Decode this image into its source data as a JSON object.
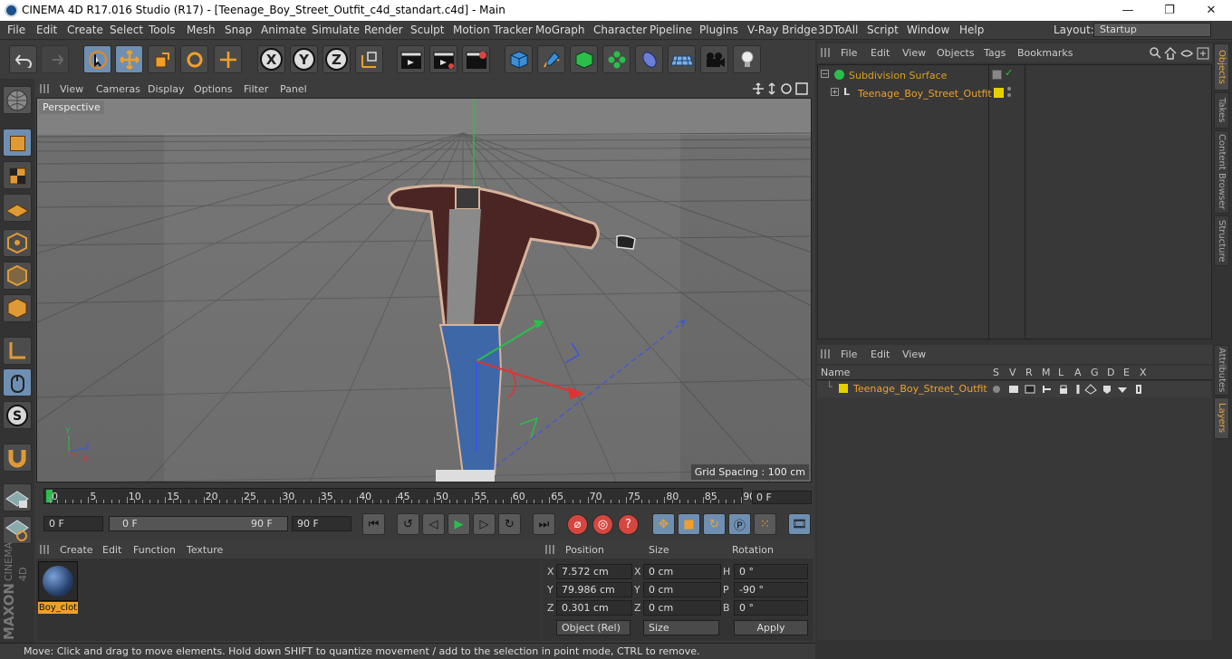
{
  "window": {
    "title": "CINEMA 4D R17.016 Studio (R17) - [Teenage_Boy_Street_Outfit_c4d_standart.c4d] - Main",
    "min_icon": "—",
    "max_icon": "❐",
    "close_icon": "✕"
  },
  "menu": [
    "File",
    "Edit",
    "Create",
    "Select",
    "Tools",
    "Mesh",
    "Snap",
    "Animate",
    "Simulate",
    "Render",
    "Sculpt",
    "Motion Tracker",
    "MoGraph",
    "Character",
    "Pipeline",
    "Plugins",
    "V-Ray Bridge",
    "3DToAll",
    "Script",
    "Window",
    "Help"
  ],
  "layout": {
    "label": "Layout:",
    "value": "Startup"
  },
  "toolbar": {
    "x": "X",
    "y": "Y",
    "z": "Z"
  },
  "viewport": {
    "menu": [
      "View",
      "Cameras",
      "Display",
      "Options",
      "Filter",
      "Panel"
    ],
    "label": "Perspective",
    "grid_spacing": "Grid Spacing : 100 cm"
  },
  "timeline": {
    "ticks": [
      "0",
      "5",
      "10",
      "15",
      "20",
      "25",
      "30",
      "35",
      "40",
      "45",
      "50",
      "55",
      "60",
      "65",
      "70",
      "75",
      "80",
      "85",
      "90"
    ],
    "current_frame": "0 F"
  },
  "transport": {
    "start": "0 F",
    "range_start": "0 F",
    "range_end": "90 F",
    "end": "90 F"
  },
  "material_manager": {
    "menu": [
      "Create",
      "Edit",
      "Function",
      "Texture"
    ],
    "material_name": "Boy_clot"
  },
  "coordinates": {
    "headers": {
      "position": "Position",
      "size": "Size",
      "rotation": "Rotation"
    },
    "rows": [
      {
        "axis": "X",
        "pos": "7.572 cm",
        "size_axis": "X",
        "size": "0 cm",
        "rot_axis": "H",
        "rot": "0 °"
      },
      {
        "axis": "Y",
        "pos": "79.986 cm",
        "size_axis": "Y",
        "size": "0 cm",
        "rot_axis": "P",
        "rot": "-90 °"
      },
      {
        "axis": "Z",
        "pos": "0.301 cm",
        "size_axis": "Z",
        "size": "0 cm",
        "rot_axis": "B",
        "rot": "0 °"
      }
    ],
    "mode": "Object (Rel)",
    "size_mode": "Size",
    "apply": "Apply"
  },
  "status": "Move: Click and drag to move elements. Hold down SHIFT to quantize movement / add to the selection in point mode, CTRL to remove.",
  "object_manager": {
    "menu": [
      "File",
      "Edit",
      "View",
      "Objects",
      "Tags",
      "Bookmarks"
    ],
    "items": [
      "Subdivision Surface",
      "Teenage_Boy_Street_Outfit"
    ]
  },
  "layer_manager": {
    "menu": [
      "File",
      "Edit",
      "View"
    ],
    "columns": [
      "Name",
      "S",
      "V",
      "R",
      "M",
      "L",
      "A",
      "G",
      "D",
      "E",
      "X"
    ],
    "items": [
      "Teenage_Boy_Street_Outfit"
    ]
  },
  "side_tabs": {
    "top": [
      "Objects",
      "Takes",
      "Content Browser",
      "Structure"
    ],
    "bottom": [
      "Attributes",
      "Layers"
    ]
  },
  "branding": {
    "maxon": "MAXON",
    "cinema": "CINEMA 4D"
  },
  "colors": {
    "accent": "#f0a02a",
    "selected": "#6f8fb2",
    "layer": "#e6d100"
  }
}
